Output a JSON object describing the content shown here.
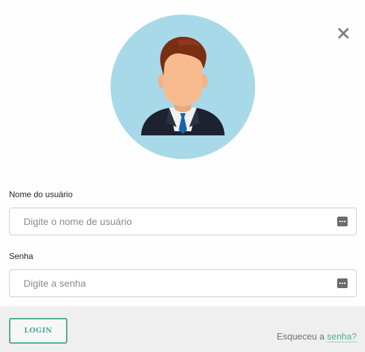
{
  "dialog": {
    "close_symbol": "×"
  },
  "form": {
    "username_label": "Nome do usuário",
    "username_placeholder": "Digite o nome de usuário",
    "username_value": "",
    "password_label": "Senha",
    "password_placeholder": "Digite a senha",
    "password_value": ""
  },
  "footer": {
    "login_label": "LOGIN",
    "forgot_prefix": "Esqueceu a",
    "forgot_link": "senha?"
  },
  "icons": {
    "close": "close-icon",
    "avatar": "user-avatar",
    "keyboard": "keyboard-icon"
  },
  "colors": {
    "accent": "#4cab9a",
    "avatar_bg": "#a8d9e8",
    "footer_bg": "#efefef",
    "field_border": "#cdcdcd"
  }
}
